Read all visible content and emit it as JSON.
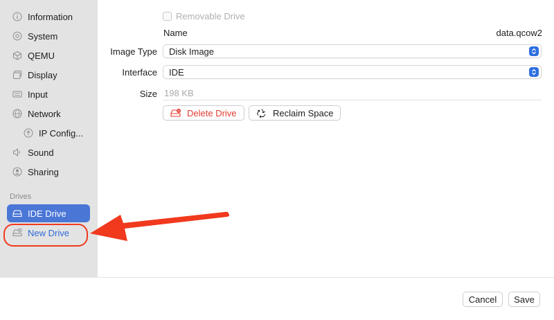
{
  "sidebar": {
    "items": [
      {
        "label": "Information",
        "icon": "info-circle-icon"
      },
      {
        "label": "System",
        "icon": "gear-icon"
      },
      {
        "label": "QEMU",
        "icon": "cube-icon"
      },
      {
        "label": "Display",
        "icon": "display-icon"
      },
      {
        "label": "Input",
        "icon": "keyboard-icon"
      },
      {
        "label": "Network",
        "icon": "globe-icon"
      },
      {
        "label": "IP Config...",
        "icon": "arrow-up-circle-icon"
      },
      {
        "label": "Sound",
        "icon": "speaker-icon"
      },
      {
        "label": "Sharing",
        "icon": "person-circle-icon"
      }
    ],
    "drives_header": "Drives",
    "drives": [
      {
        "label": "IDE Drive",
        "icon": "drive-icon",
        "selected": true
      },
      {
        "label": "New Drive",
        "icon": "drive-add-icon",
        "selected": false
      }
    ]
  },
  "drive": {
    "removable_label": "Removable Drive",
    "name_label": "Name",
    "name_value": "data.qcow2",
    "image_type_label": "Image Type",
    "image_type_value": "Disk Image",
    "interface_label": "Interface",
    "interface_value": "IDE",
    "size_label": "Size",
    "size_placeholder": "198 KB",
    "delete_label": "Delete Drive",
    "reclaim_label": "Reclaim Space"
  },
  "footer": {
    "cancel_label": "Cancel",
    "save_label": "Save"
  },
  "colors": {
    "accent": "#4a76d6",
    "annotation_red": "#f1391e",
    "delete_red": "#e33b2f"
  }
}
